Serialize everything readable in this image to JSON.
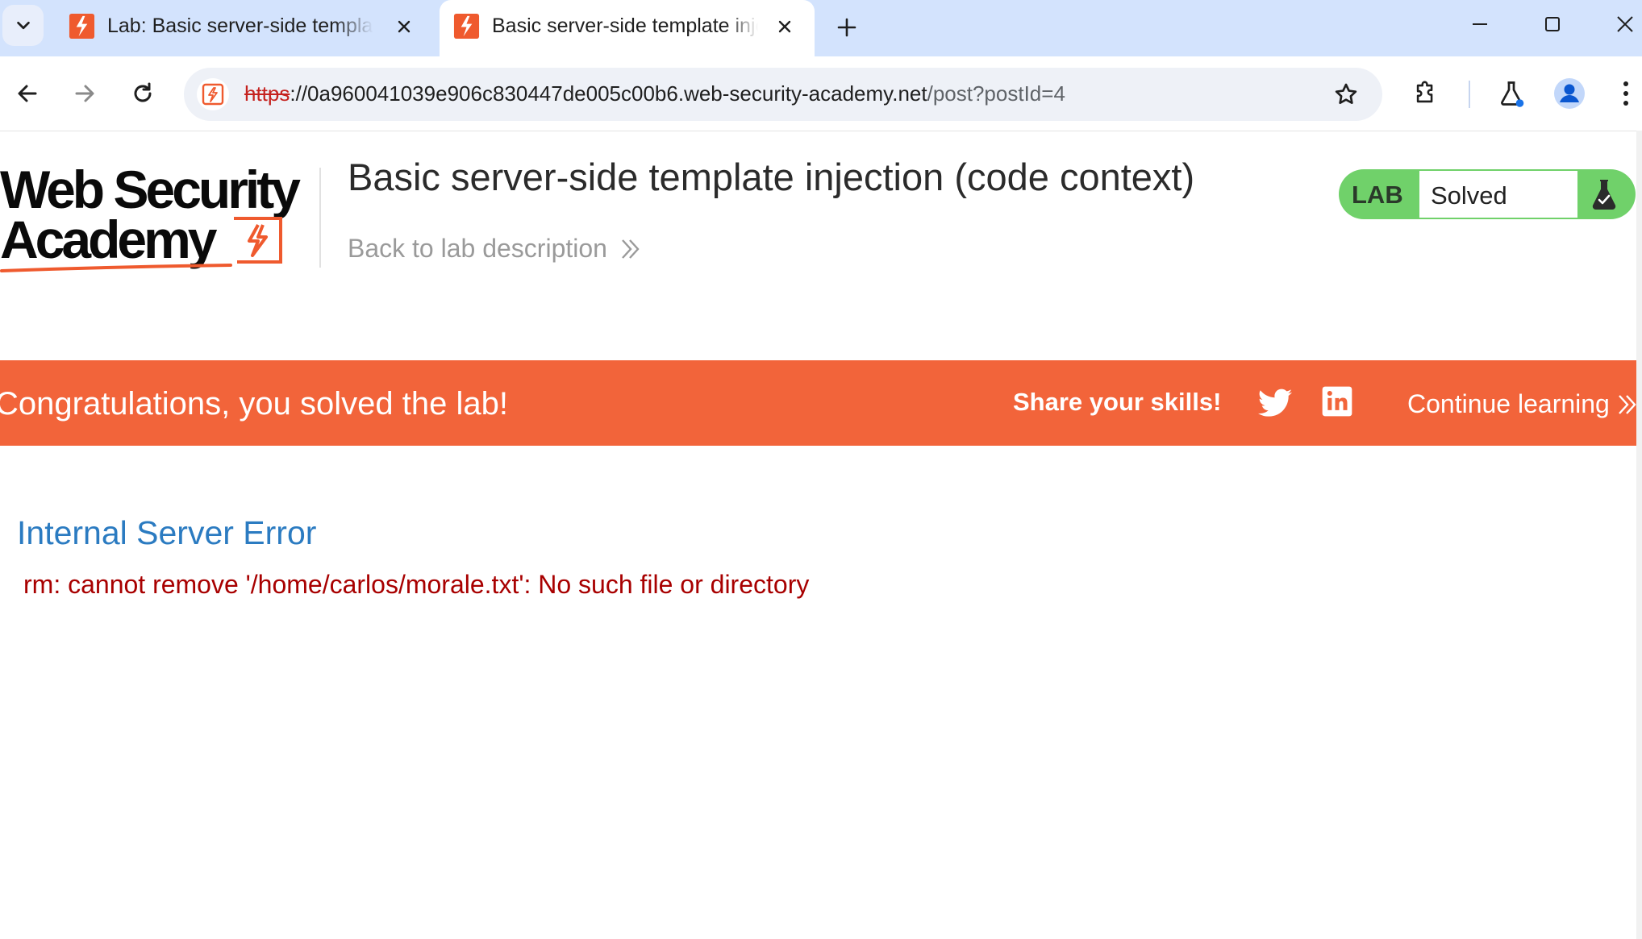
{
  "browser": {
    "tabs": [
      {
        "title": "Lab: Basic server-side template injection (code context)",
        "active": false
      },
      {
        "title": "Basic server-side template injection (code context)",
        "active": true
      }
    ],
    "address_bar": {
      "scheme": "https",
      "host_rest": "://0a960041039e906c830447de005c00b6.web-security-academy.net",
      "path": "/post?postId=4"
    },
    "colors": {
      "tabstrip": "#d3e3fd",
      "omnibox": "#eef1f7"
    }
  },
  "header": {
    "logo_line1": "Web Security",
    "logo_line2": "Academy",
    "lab_title": "Basic server-side template injection (code context)",
    "back_link": "Back to lab description",
    "lab_badge": "LAB",
    "lab_status": "Solved"
  },
  "banner": {
    "message": "Congratulations, you solved the lab!",
    "share_label": "Share your skills!",
    "continue_label": "Continue learning",
    "color": "#f2643a"
  },
  "content": {
    "error_title": "Internal Server Error",
    "error_message": "rm: cannot remove '/home/carlos/morale.txt': No such file or directory"
  }
}
